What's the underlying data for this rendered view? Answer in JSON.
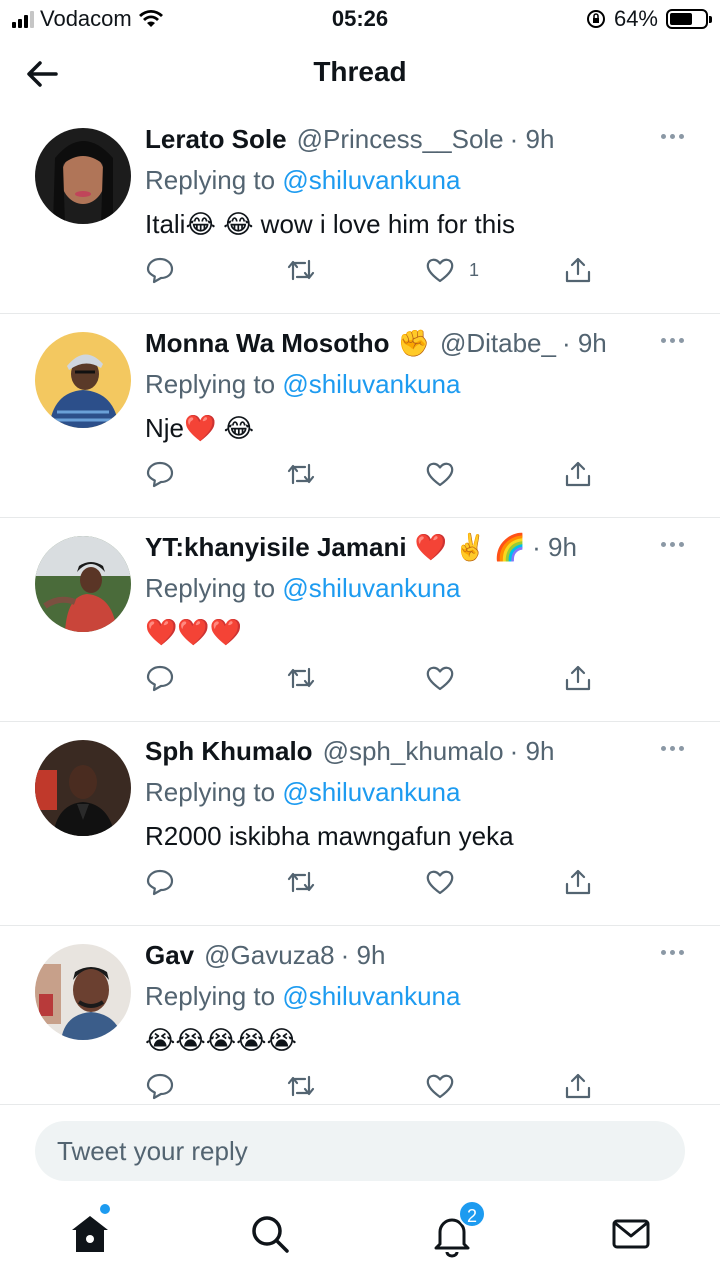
{
  "status_bar": {
    "carrier": "Vodacom",
    "time": "05:26",
    "battery": "64%",
    "battery_level": 0.64
  },
  "header": {
    "title": "Thread",
    "back_icon": "arrow-left-icon"
  },
  "replying_label": "Replying to",
  "tweets": [
    {
      "name": "Lerato Sole",
      "name_emoji": "",
      "handle": "@Princess__Sole",
      "time": "· 9h",
      "mention": "@shiluvankuna",
      "text": "Itali😂 😂  wow i love him for this",
      "like_count": "1"
    },
    {
      "name": "Monna Wa Mosotho",
      "name_emoji": "✊",
      "handle": "@Ditabe_",
      "time": "· 9h",
      "mention": "@shiluvankuna",
      "text": "Nje❤️ 😂",
      "like_count": ""
    },
    {
      "name": "YT:khanyisile Jamani",
      "name_emoji": "❤️ ✌️ 🌈",
      "handle": "",
      "time": "· 9h",
      "mention": "@shiluvankuna",
      "text": "❤️❤️❤️",
      "like_count": ""
    },
    {
      "name": "Sph Khumalo",
      "name_emoji": "",
      "handle": "@sph_khumalo",
      "time": "· 9h",
      "mention": "@shiluvankuna",
      "text": "R2000 iskibha mawngafun yeka",
      "like_count": ""
    },
    {
      "name": "Gav",
      "name_emoji": "",
      "handle": "@Gavuza8",
      "time": "· 9h",
      "mention": "@shiluvankuna",
      "text": "😭😭😭😭😭",
      "like_count": ""
    }
  ],
  "reply_bar": {
    "placeholder": "Tweet your reply"
  },
  "tab_bar": {
    "notifications_badge": "2"
  },
  "colors": {
    "accent": "#1d9bf0",
    "secondary_text": "#536471",
    "divider": "#e7e9ea"
  }
}
